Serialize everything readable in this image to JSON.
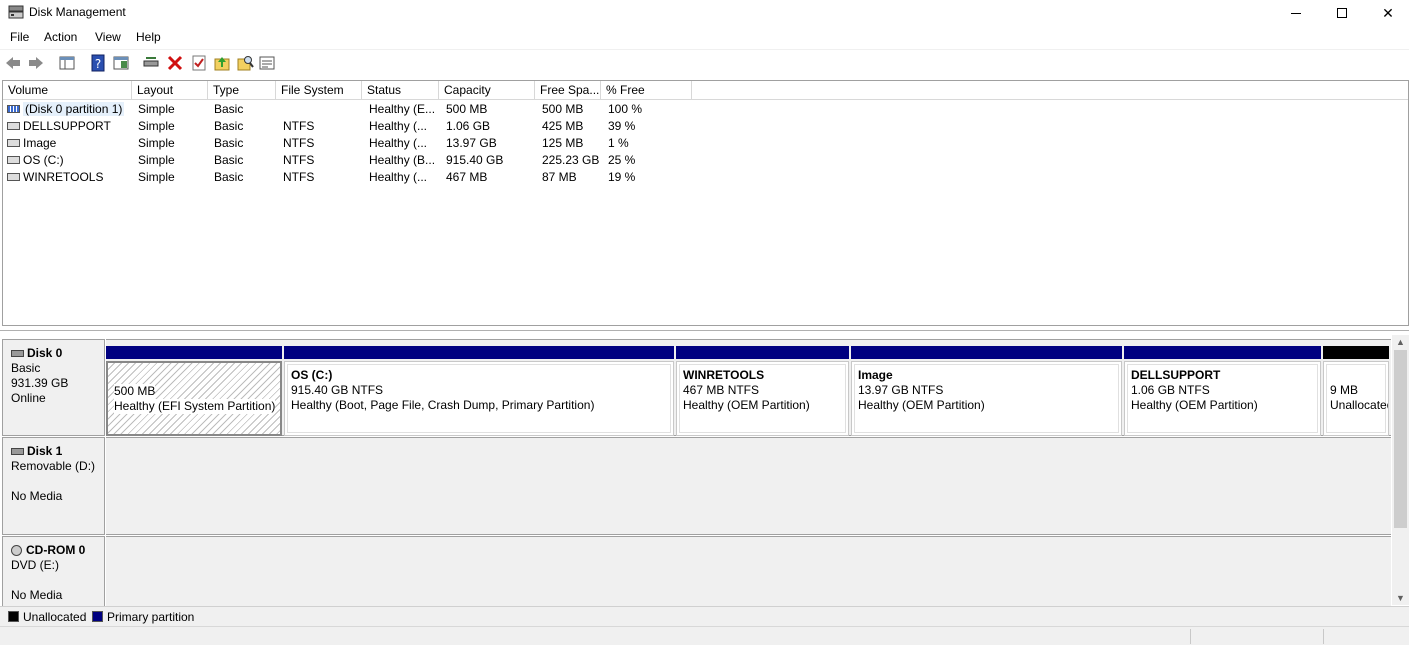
{
  "window": {
    "title": "Disk Management",
    "minimize": "—",
    "maximize": "☐",
    "close": "✕"
  },
  "menu": [
    "File",
    "Action",
    "View",
    "Help"
  ],
  "table": {
    "columns": [
      "Volume",
      "Layout",
      "Type",
      "File System",
      "Status",
      "Capacity",
      "Free Spa...",
      "% Free"
    ],
    "rows": [
      [
        "(Disk 0 partition 1)",
        "Simple",
        "Basic",
        "",
        "Healthy (E...",
        "500 MB",
        "500 MB",
        "100 %"
      ],
      [
        "DELLSUPPORT",
        "Simple",
        "Basic",
        "NTFS",
        "Healthy (...",
        "1.06 GB",
        "425 MB",
        "39 %"
      ],
      [
        "Image",
        "Simple",
        "Basic",
        "NTFS",
        "Healthy (...",
        "13.97 GB",
        "125 MB",
        "1 %"
      ],
      [
        "OS (C:)",
        "Simple",
        "Basic",
        "NTFS",
        "Healthy (B...",
        "915.40 GB",
        "225.23 GB",
        "25 %"
      ],
      [
        "WINRETOOLS",
        "Simple",
        "Basic",
        "NTFS",
        "Healthy (...",
        "467 MB",
        "87 MB",
        "19 %"
      ]
    ]
  },
  "disks": [
    {
      "name": "Disk 0",
      "line2": "Basic",
      "line3": "931.39 GB",
      "line4": "Online",
      "partitions": [
        {
          "title": "",
          "size": "500 MB",
          "status": "Healthy (EFI System Partition)"
        },
        {
          "title": "OS  (C:)",
          "size": "915.40 GB NTFS",
          "status": "Healthy (Boot, Page File, Crash Dump, Primary Partition)"
        },
        {
          "title": "WINRETOOLS",
          "size": "467 MB NTFS",
          "status": "Healthy (OEM Partition)"
        },
        {
          "title": "Image",
          "size": "13.97 GB NTFS",
          "status": "Healthy (OEM Partition)"
        },
        {
          "title": "DELLSUPPORT",
          "size": "1.06 GB NTFS",
          "status": "Healthy (OEM Partition)"
        },
        {
          "title": "",
          "size": "9 MB",
          "status": "Unallocated"
        }
      ]
    },
    {
      "name": "Disk 1",
      "line2": "Removable (D:)",
      "line3": "",
      "line4": "No Media"
    },
    {
      "name": "CD-ROM 0",
      "line2": "DVD (E:)",
      "line3": "",
      "line4": "No Media"
    }
  ],
  "legend": {
    "unallocated": "Unallocated",
    "primary": "Primary partition"
  },
  "colors": {
    "primary": "#000080",
    "unallocated": "#000000"
  }
}
